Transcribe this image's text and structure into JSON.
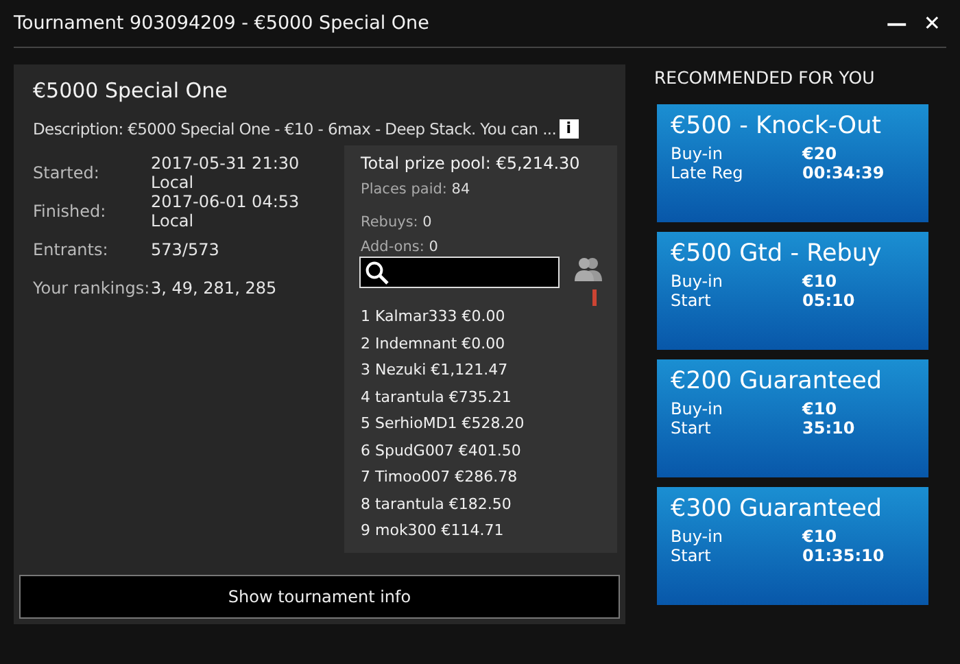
{
  "window": {
    "title": "Tournament 903094209 - €5000 Special One",
    "minimize": "—",
    "close": "✕"
  },
  "details": {
    "name": "€5000 Special One",
    "description": "Description: €5000 Special One - €10 - 6max - Deep Stack. You can ...",
    "info_icon": "i",
    "fields": [
      {
        "label": "Started:",
        "value": "2017-05-31 21:30\nLocal"
      },
      {
        "label": "Finished:",
        "value": "2017-06-01 04:53\nLocal"
      },
      {
        "label": "Entrants:",
        "value": "573/573"
      },
      {
        "label": "Your rankings:",
        "value": "3, 49, 281, 285"
      }
    ]
  },
  "prizes": {
    "total": "Total prize pool: €5,214.30",
    "places_paid": {
      "label": "Places paid:",
      "value": "84"
    },
    "rebuys": {
      "label": "Rebuys:",
      "value": "0"
    },
    "addons": {
      "label": "Add-ons:",
      "value": "0"
    },
    "results": [
      "1 Kalmar333 €0.00",
      "2 Indemnant €0.00",
      "3 Nezuki €1,121.47",
      "4 tarantula €735.21",
      "5 SerhioMD1 €528.20",
      "6 SpudG007 €401.50",
      "7 Timoo007 €286.78",
      "8 tarantula €182.50",
      "9 mok300 €114.71"
    ]
  },
  "show_info_button": "Show tournament info",
  "recommended": {
    "heading": "RECOMMENDED FOR YOU",
    "cards": [
      {
        "title": "€500 - Knock-Out",
        "rows": [
          {
            "label": "Buy-in",
            "value": "€20"
          },
          {
            "label": "Late Reg",
            "value": "00:34:39"
          }
        ]
      },
      {
        "title": "€500 Gtd - Rebuy",
        "rows": [
          {
            "label": "Buy-in",
            "value": "€10"
          },
          {
            "label": "Start",
            "value": "05:10"
          }
        ]
      },
      {
        "title": "€200 Guaranteed",
        "rows": [
          {
            "label": "Buy-in",
            "value": "€10"
          },
          {
            "label": "Start",
            "value": "35:10"
          }
        ]
      },
      {
        "title": "€300 Guaranteed",
        "rows": [
          {
            "label": "Buy-in",
            "value": "€10"
          },
          {
            "label": "Start",
            "value": "01:35:10"
          }
        ]
      }
    ]
  }
}
